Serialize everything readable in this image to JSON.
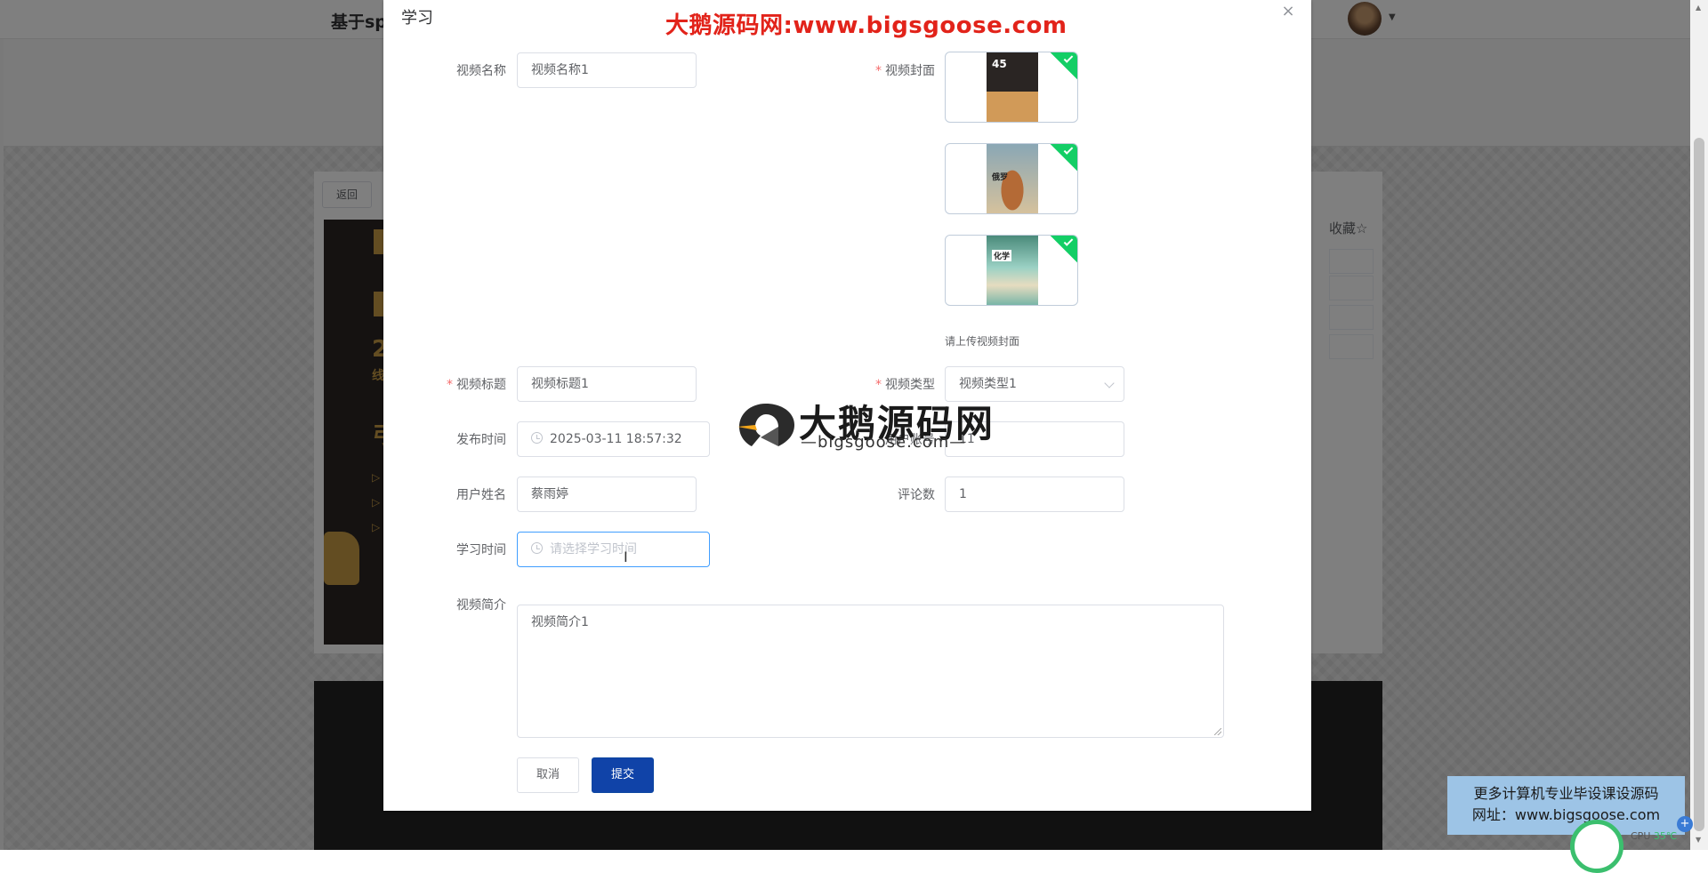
{
  "background": {
    "site_title": "基于sp",
    "back_label": "返回",
    "poster_letter": "2",
    "poster_sub": "线",
    "poster_char": "弓",
    "arrow": "▷",
    "collect_label": "收藏☆"
  },
  "watermark": {
    "top": "大鹅源码网:www.bigsgoose.com",
    "logo": "大鹅源码网",
    "logo_sub": "—bigsgoose.com—"
  },
  "dialog": {
    "title": "学习",
    "close": "×"
  },
  "form": {
    "video_name": {
      "label": "视频名称",
      "value": "视频名称1"
    },
    "video_cover": {
      "label": "视频封面",
      "tip": "请上传视频封面",
      "thumb1_text": "45",
      "thumb2_text": "俄罗",
      "thumb3_text": "化学"
    },
    "video_title": {
      "label": "视频标题",
      "value": "视频标题1"
    },
    "video_type": {
      "label": "视频类型",
      "value": "视频类型1"
    },
    "publish_time": {
      "label": "发布时间",
      "value": "2025-03-11 18:57:32"
    },
    "user_account": {
      "label": "用户账号",
      "value": "11"
    },
    "user_name": {
      "label": "用户姓名",
      "value": "蔡雨婷"
    },
    "comment_count": {
      "label": "评论数",
      "value": "1"
    },
    "study_time": {
      "label": "学习时间",
      "placeholder": "请选择学习时间"
    },
    "video_intro": {
      "label": "视频简介",
      "value": "视频简介1"
    }
  },
  "buttons": {
    "cancel": "取消",
    "submit": "提交"
  },
  "ad": {
    "line1": "更多计算机专业毕设课设源码",
    "line2": "网址：www.bigsgoose.com"
  },
  "cpu": {
    "label": "CPU",
    "value": "35℃"
  },
  "colors": {
    "primary": "#1043a8",
    "required": "#f56c6c",
    "watermark_red": "#e2231a",
    "success_badge": "#13ce66"
  }
}
